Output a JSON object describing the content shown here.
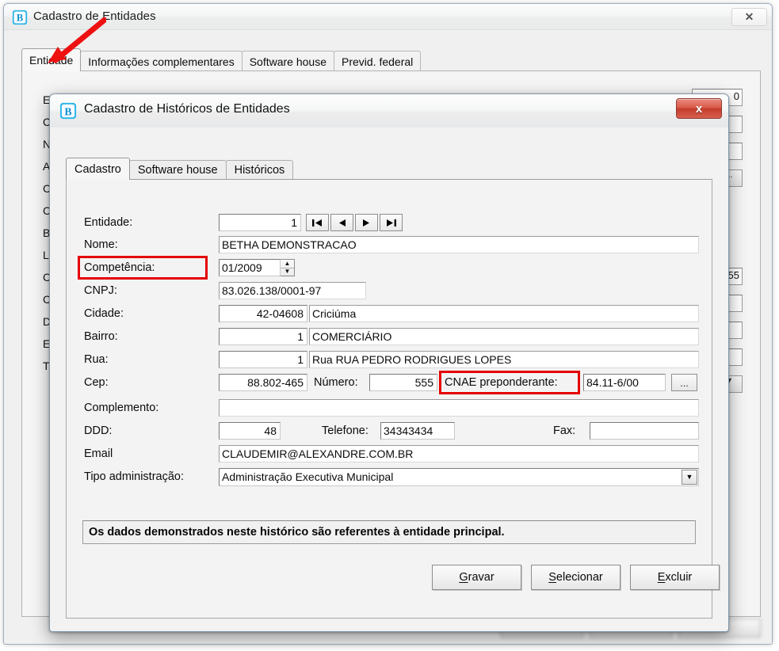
{
  "background_window": {
    "title": "Cadastro de Entidades",
    "icon": "betha-b-logo-icon",
    "close_label": "✕",
    "tabs": [
      {
        "label": "Entidade",
        "active": true
      },
      {
        "label": "Informações complementares",
        "active": false
      },
      {
        "label": "Software house",
        "active": false
      },
      {
        "label": "Previd. federal",
        "active": false
      }
    ],
    "partial_labels": [
      "En",
      "CN",
      "No",
      "Ap",
      "Co",
      "Ci",
      "Ba",
      "Lo",
      "Ce",
      "Co",
      "DD",
      "En",
      "Ti"
    ],
    "partial_values": {
      "right_top": "0",
      "right_numero": "55",
      "dots_button": "...",
      "combo_arrow": "▼"
    }
  },
  "modal": {
    "title": "Cadastro de Históricos de Entidades",
    "icon": "betha-b-logo-icon",
    "close_label": "x",
    "tabs": [
      {
        "label": "Cadastro",
        "active": true
      },
      {
        "label": "Software house",
        "active": false
      },
      {
        "label": "Históricos",
        "active": false
      }
    ],
    "fields": {
      "entidade": {
        "label": "Entidade:",
        "value": "1"
      },
      "nome": {
        "label": "Nome:",
        "value": "BETHA DEMONSTRACAO"
      },
      "competencia": {
        "label": "Competência:",
        "value": "01/2009",
        "highlighted": true
      },
      "cnpj": {
        "label": "CNPJ:",
        "value": "83.026.138/0001-97"
      },
      "cidade": {
        "label": "Cidade:",
        "code": "42-04608",
        "name": "Criciúma"
      },
      "bairro": {
        "label": "Bairro:",
        "code": "1",
        "name": "COMERCIÁRIO"
      },
      "rua": {
        "label": "Rua:",
        "code": "1",
        "name": "Rua RUA PEDRO RODRIGUES LOPES"
      },
      "cep": {
        "label": "Cep:",
        "value": "88.802-465"
      },
      "numero": {
        "label": "Número:",
        "value": "555"
      },
      "cnae": {
        "label": "CNAE preponderante:",
        "value": "84.11-6/00",
        "browse": "...",
        "highlighted": true
      },
      "complemento": {
        "label": "Complemento:",
        "value": ""
      },
      "ddd": {
        "label": "DDD:",
        "value": "48"
      },
      "telefone": {
        "label": "Telefone:",
        "value": "34343434"
      },
      "fax": {
        "label": "Fax:",
        "value": ""
      },
      "email": {
        "label": "Email",
        "value": "CLAUDEMIR@ALEXANDRE.COM.BR"
      },
      "tipo_administracao": {
        "label": "Tipo administração:",
        "value": "Administração Executiva Municipal",
        "arrow": "▼"
      }
    },
    "nav_buttons": [
      {
        "name": "first",
        "glyph": "❘◀"
      },
      {
        "name": "previous",
        "glyph": "◀"
      },
      {
        "name": "next",
        "glyph": "▶"
      },
      {
        "name": "last",
        "glyph": "▶❘"
      }
    ],
    "spinner": {
      "up": "▲",
      "down": "▼"
    },
    "note": "Os dados demonstrados neste histórico são referentes à entidade principal.",
    "buttons": [
      {
        "label": "Gravar",
        "accel": "G",
        "rest": "ravar"
      },
      {
        "label": "Selecionar",
        "accel": "S",
        "rest": "elecionar"
      },
      {
        "label": "Excluir",
        "accel": "E",
        "rest": "xcluir"
      }
    ]
  },
  "annotations": {
    "arrow_color": "#ee1111",
    "highlight_color": "#e50000"
  }
}
